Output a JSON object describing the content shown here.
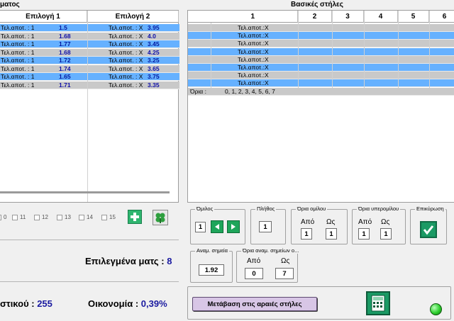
{
  "left": {
    "title": "ματος",
    "col1_header": "Επιλογή 1",
    "col2_header": "Επιλογή 2",
    "rows": [
      {
        "a_label": "Τελ.αποτ. : 1",
        "a_val": "1.5",
        "b_label": "Τελ.αποτ. : X",
        "b_val": "3.95",
        "style": "blue"
      },
      {
        "a_label": "Τελ.αποτ. : 1",
        "a_val": "1.68",
        "b_label": "Τελ.αποτ. : X",
        "b_val": "4.0",
        "style": "gray"
      },
      {
        "a_label": "Τελ.αποτ. : 1",
        "a_val": "1.77",
        "b_label": "Τελ.αποτ. : X",
        "b_val": "3.45",
        "style": "blue"
      },
      {
        "a_label": "Τελ.αποτ. : 1",
        "a_val": "1.68",
        "b_label": "Τελ.αποτ. : X",
        "b_val": "4.25",
        "style": "gray"
      },
      {
        "a_label": "Τελ.αποτ. : 1",
        "a_val": "1.72",
        "b_label": "Τελ.αποτ. : X",
        "b_val": "3.25",
        "style": "blue"
      },
      {
        "a_label": "Τελ.αποτ. : 1",
        "a_val": "1.74",
        "b_label": "Τελ.αποτ. : X",
        "b_val": "3.65",
        "style": "gray"
      },
      {
        "a_label": "Τελ.αποτ. : 1",
        "a_val": "1.65",
        "b_label": "Τελ.αποτ. : X",
        "b_val": "3.75",
        "style": "blue"
      },
      {
        "a_label": "Τελ.αποτ. : 1",
        "a_val": "1.71",
        "b_label": "Τελ.αποτ. : X",
        "b_val": "3.35",
        "style": "gray"
      }
    ],
    "checkbox_labels": [
      "0",
      "11",
      "12",
      "13",
      "14",
      "15"
    ]
  },
  "right": {
    "title": "Βασικές στήλες",
    "col_headers": [
      "1",
      "2",
      "3",
      "4",
      "5",
      "6"
    ],
    "rows": [
      {
        "value": "Τελ.αποτ.:X",
        "style": "gray"
      },
      {
        "value": "Τελ.αποτ.:X",
        "style": "blue"
      },
      {
        "value": "Τελ.αποτ.:X",
        "style": "gray"
      },
      {
        "value": "Τελ.αποτ.:X",
        "style": "blue"
      },
      {
        "value": "Τελ.αποτ.:X",
        "style": "gray"
      },
      {
        "value": "Τελ.αποτ.:X",
        "style": "blue"
      },
      {
        "value": "Τελ.αποτ.:X",
        "style": "gray"
      },
      {
        "value": "Τελ.αποτ.:X",
        "style": "blue"
      }
    ],
    "limits_label": "Όρια :",
    "limits_value": "0, 1, 2, 3, 4, 5, 6, 7"
  },
  "controls": {
    "omilos_title": "Όμιλος",
    "omilos_value": "1",
    "plithos_title": "Πλήθος",
    "plithos_value": "1",
    "oria_omilou_title": "Όρια ομίλου",
    "oria_omilou_from_label": "Από",
    "oria_omilou_to_label": "Ως",
    "oria_omilou_from": "1",
    "oria_omilou_to": "1",
    "oria_yperomilou_title": "Όρια υπερομίλου",
    "oria_yperomilou_from_label": "Από",
    "oria_yperomilou_to_label": "Ως",
    "oria_yperomilou_from": "1",
    "oria_yperomilou_to": "1",
    "epikyrosi_title": "Επικύρωση",
    "anam_title": "Αναμ. σημεία",
    "anam_value": "1.92",
    "oria_anam_title": "Όρια αναμ. σημείων ο...",
    "oria_anam_from_label": "Από",
    "oria_anam_to_label": "Ως",
    "oria_anam_from": "0",
    "oria_anam_to": "7",
    "transfer_button": "Μετάβαση στις αραιές στήλες"
  },
  "summary": {
    "selected_label": "Επιλεγμένα ματς :",
    "selected_value": "8",
    "sticky_label": "στικού :",
    "sticky_value": "255",
    "economy_label": "Οικονομία :",
    "economy_value": "0,39%"
  },
  "colors": {
    "blue_row": "#66b1ff",
    "gray_row": "#c9c9c9",
    "value_blue": "#1a1aa0",
    "button_purple": "#d8c6e6",
    "status_green": "#2dcf2d"
  }
}
